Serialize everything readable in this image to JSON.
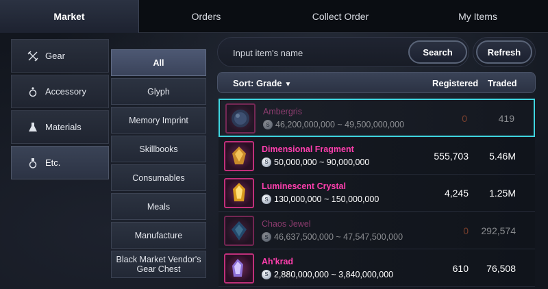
{
  "tabs": [
    {
      "label": "Market",
      "active": true
    },
    {
      "label": "Orders",
      "active": false
    },
    {
      "label": "Collect Order",
      "active": false
    },
    {
      "label": "My Items",
      "active": false
    }
  ],
  "categories": [
    {
      "label": "Gear",
      "icon": "crossed-swords-icon",
      "active": false
    },
    {
      "label": "Accessory",
      "icon": "ring-icon",
      "active": false
    },
    {
      "label": "Materials",
      "icon": "flask-icon",
      "active": false
    },
    {
      "label": "Etc.",
      "icon": "potion-icon",
      "active": true
    }
  ],
  "subcategories": [
    {
      "label": "All",
      "active": true
    },
    {
      "label": "Glyph",
      "active": false
    },
    {
      "label": "Memory Imprint",
      "active": false
    },
    {
      "label": "Skillbooks",
      "active": false
    },
    {
      "label": "Consumables",
      "active": false
    },
    {
      "label": "Meals",
      "active": false
    },
    {
      "label": "Manufacture",
      "active": false
    },
    {
      "label": "Black Market Vendor's Gear Chest",
      "active": false
    }
  ],
  "search": {
    "placeholder": "Input item's name",
    "value": "",
    "button_label": "Search"
  },
  "refresh_label": "Refresh",
  "list_header": {
    "sort_label": "Sort: Grade",
    "registered_label": "Registered",
    "traded_label": "Traded"
  },
  "items": [
    {
      "name": "Ambergris",
      "price": "46,200,000,000 ~ 49,500,000,000",
      "registered": "0",
      "traded": "419",
      "dim": true,
      "selected": true,
      "icon": "ambergris-orb-icon"
    },
    {
      "name": "Dimensional Fragment",
      "price": "50,000,000 ~ 90,000,000",
      "registered": "555,703",
      "traded": "5.46M",
      "dim": false,
      "selected": false,
      "icon": "fragment-crystal-icon"
    },
    {
      "name": "Luminescent Crystal",
      "price": "130,000,000 ~ 150,000,000",
      "registered": "4,245",
      "traded": "1.25M",
      "dim": false,
      "selected": false,
      "icon": "gold-crystal-icon"
    },
    {
      "name": "Chaos Jewel",
      "price": "46,637,500,000 ~ 47,547,500,000",
      "registered": "0",
      "traded": "292,574",
      "dim": true,
      "selected": false,
      "icon": "blue-jewel-icon"
    },
    {
      "name": "Ah'krad",
      "price": "2,880,000,000 ~ 3,840,000,000",
      "registered": "610",
      "traded": "76,508",
      "dim": false,
      "selected": false,
      "icon": "violet-crystal-icon"
    }
  ],
  "colors": {
    "accent_selected": "#3fd6e0",
    "item_name": "#ff3fae",
    "zero_registered": "#e0673a"
  }
}
